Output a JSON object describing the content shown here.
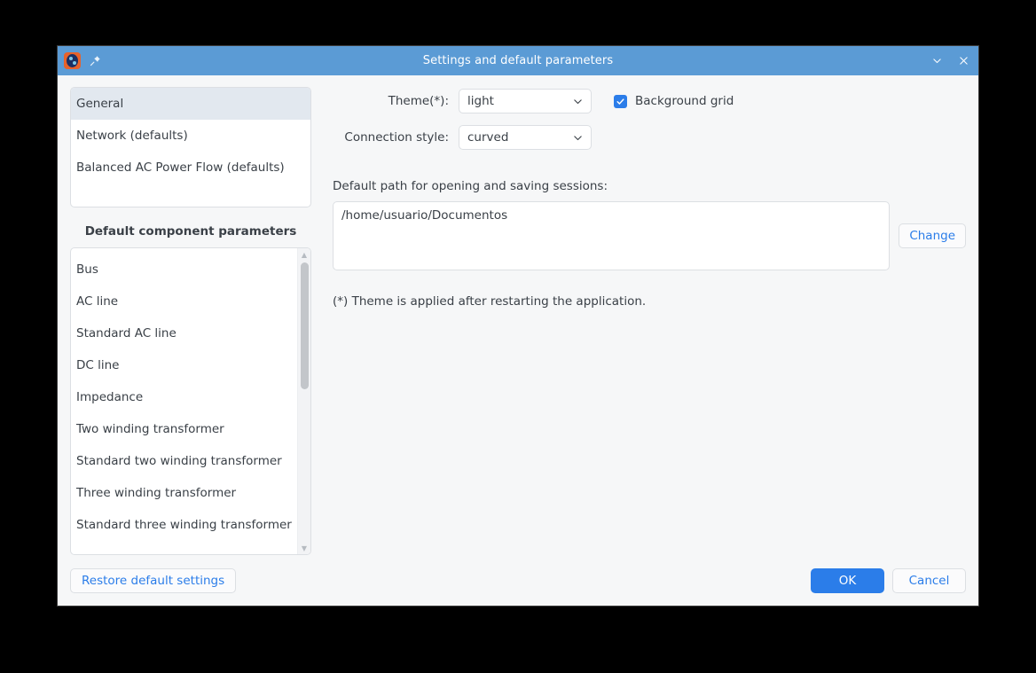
{
  "window": {
    "title": "Settings and default parameters",
    "app_icon": "gridcal-app-icon",
    "pin_icon": "pin-icon",
    "minimize_icon": "chevron-down-icon",
    "close_icon": "close-icon",
    "titlebar_color": "#5b9bd5",
    "accent_color": "#2b7de9"
  },
  "sidebar": {
    "sections": [
      {
        "label": "General",
        "selected": true
      },
      {
        "label": "Network (defaults)",
        "selected": false
      },
      {
        "label": "Balanced AC Power Flow (defaults)",
        "selected": false
      }
    ],
    "defaults_header": "Default component parameters",
    "components": [
      {
        "label": "Bus"
      },
      {
        "label": "AC line"
      },
      {
        "label": "Standard AC line"
      },
      {
        "label": "DC line"
      },
      {
        "label": "Impedance"
      },
      {
        "label": "Two winding transformer"
      },
      {
        "label": "Standard two winding transformer"
      },
      {
        "label": "Three winding transformer"
      },
      {
        "label": "Standard three winding transformer"
      }
    ]
  },
  "general": {
    "theme": {
      "label": "Theme(*):",
      "value": "light"
    },
    "background_grid": {
      "label": "Background grid",
      "checked": true
    },
    "connection_style": {
      "label": "Connection style:",
      "value": "curved"
    },
    "default_path": {
      "label": "Default path for opening and saving sessions:",
      "value": "/home/usuario/Documentos",
      "change_label": "Change"
    },
    "note": "(*) Theme is applied after restarting the application."
  },
  "footer": {
    "restore_label": "Restore default settings",
    "ok_label": "OK",
    "cancel_label": "Cancel"
  }
}
